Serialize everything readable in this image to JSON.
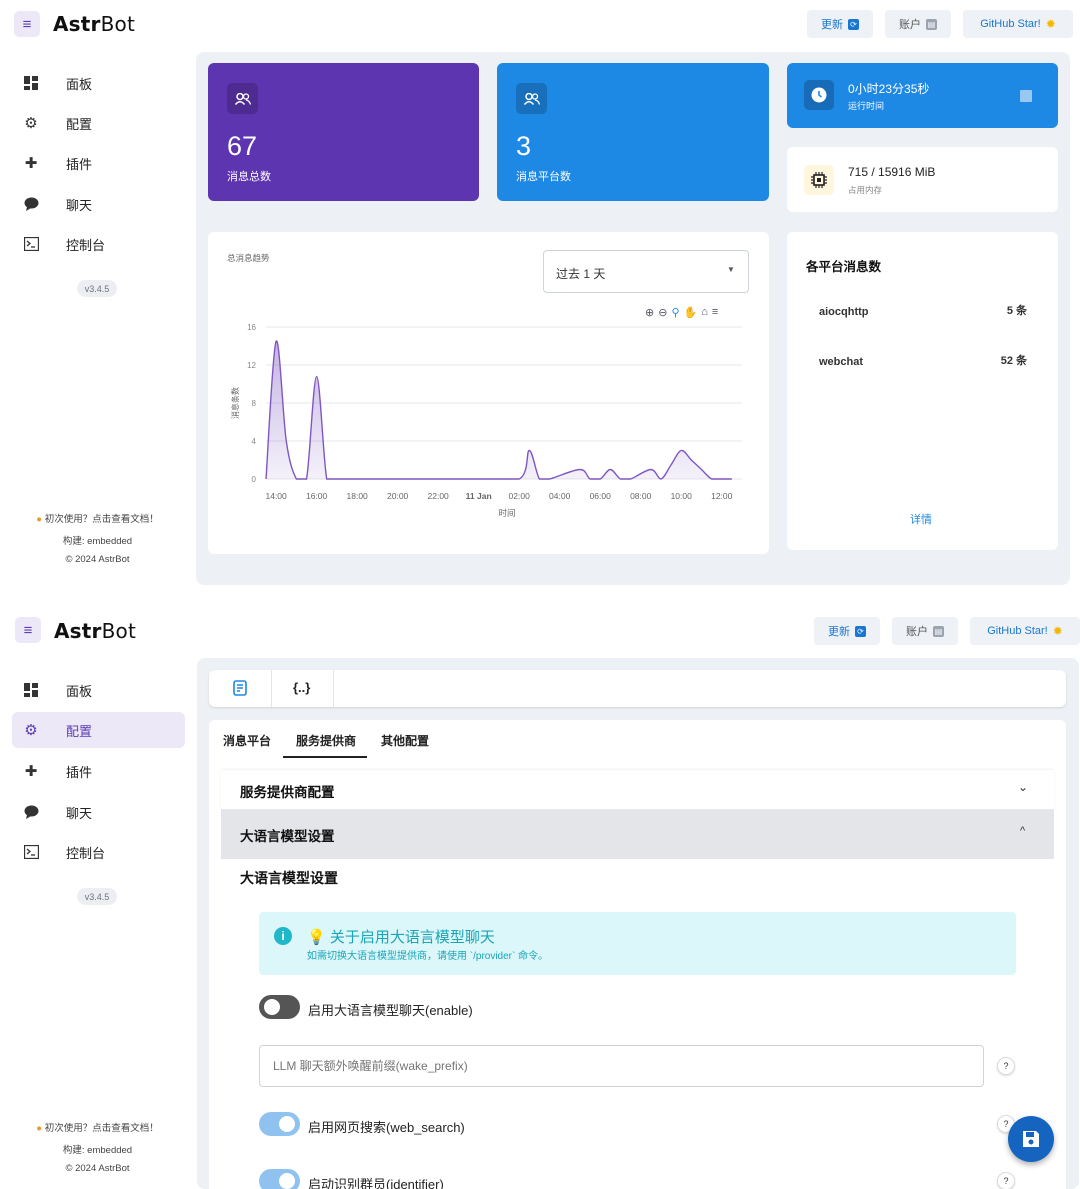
{
  "app": {
    "name_bold": "Astr",
    "name_rest": "Bot",
    "buttons": {
      "update": "更新",
      "account": "账户",
      "github": "GitHub Star!"
    },
    "version": "v3.4.5",
    "footer": {
      "hint": "初次使用？点击查看文档！",
      "build": "构建: embedded",
      "copyright": "© 2024 AstrBot"
    },
    "colors": {
      "brand": "#5b3db5",
      "blue": "#1e88e5",
      "teal": "#26c6da"
    }
  },
  "sidebar": {
    "items": [
      {
        "label": "面板",
        "icon": "dashboard-icon"
      },
      {
        "label": "配置",
        "icon": "gear-icon"
      },
      {
        "label": "插件",
        "icon": "puzzle-icon"
      },
      {
        "label": "聊天",
        "icon": "chat-bubble-icon"
      },
      {
        "label": "控制台",
        "icon": "terminal-icon"
      }
    ]
  },
  "dashboard": {
    "total_messages": {
      "value": "67",
      "label": "消息总数"
    },
    "platforms": {
      "value": "3",
      "label": "消息平台数"
    },
    "uptime": {
      "value": "0小时23分35秒",
      "label": "运行时间"
    },
    "memory": {
      "value": "715 / 15916 MiB",
      "label": "占用内存"
    },
    "trend_title": "总消息趋势",
    "range_select": "过去 1 天",
    "platform_card": {
      "title": "各平台消息数",
      "rows": [
        {
          "name": "aiocqhttp",
          "count": "5 条"
        },
        {
          "name": "webchat",
          "count": "52 条"
        }
      ],
      "details": "详情"
    }
  },
  "chart_data": {
    "type": "area",
    "title": "",
    "xlabel": "时间",
    "ylabel": "消息条数",
    "ylim": [
      0,
      16
    ],
    "y_ticks": [
      "0",
      "4",
      "8",
      "12",
      "16"
    ],
    "x_ticks": [
      "14:00",
      "16:00",
      "18:00",
      "20:00",
      "22:00",
      "11 Jan",
      "02:00",
      "04:00",
      "06:00",
      "08:00",
      "10:00",
      "12:00"
    ],
    "x_hours": [
      13.5,
      14.0,
      14.5,
      15.0,
      15.5,
      16.0,
      16.5,
      17.0,
      20.0,
      23.5,
      26.0,
      26.5,
      27.0,
      27.5,
      29.0,
      29.5,
      30.0,
      30.5,
      31.0,
      31.5,
      32.5,
      33.0,
      33.5,
      34.0,
      34.5,
      35.0,
      35.5,
      36.0,
      36.5
    ],
    "values": [
      0,
      14.5,
      4,
      0,
      0,
      10.8,
      0,
      0,
      0,
      0,
      0,
      3,
      0,
      0,
      1,
      0,
      0,
      1,
      0,
      0,
      1,
      0,
      1.5,
      3,
      2,
      1,
      0,
      0,
      0
    ],
    "grid": true,
    "series_color": "#7e57c2",
    "toolbar_icons": [
      "zoom-in-icon",
      "zoom-out-icon",
      "magnify-icon",
      "pan-hand-icon",
      "home-icon",
      "menu-icon"
    ]
  },
  "config": {
    "toolbar_icons": [
      "form-edit-icon",
      "code-braces-icon"
    ],
    "code_icon_text": "{..}",
    "tabs": [
      "消息平台",
      "服务提供商",
      "其他配置"
    ],
    "active_tab": "服务提供商",
    "sections": {
      "provider": "服务提供商配置",
      "llm_header": "大语言模型设置",
      "llm_title": "大语言模型设置"
    },
    "alert": {
      "title": "💡 关于启用大语言模型聊天",
      "body": "如需切换大语言模型提供商，请使用 `/provider` 命令。"
    },
    "fields": {
      "enable": {
        "label": "启用大语言模型聊天(enable)",
        "on": false
      },
      "wake_prefix": {
        "placeholder": "LLM 聊天额外唤醒前缀(wake_prefix)",
        "help": "?"
      },
      "web_search": {
        "label": "启用网页搜索(web_search)",
        "on": true,
        "help": "?"
      },
      "identifier": {
        "label": "启动识别群员(identifier)",
        "on": true,
        "help": "?"
      }
    }
  }
}
